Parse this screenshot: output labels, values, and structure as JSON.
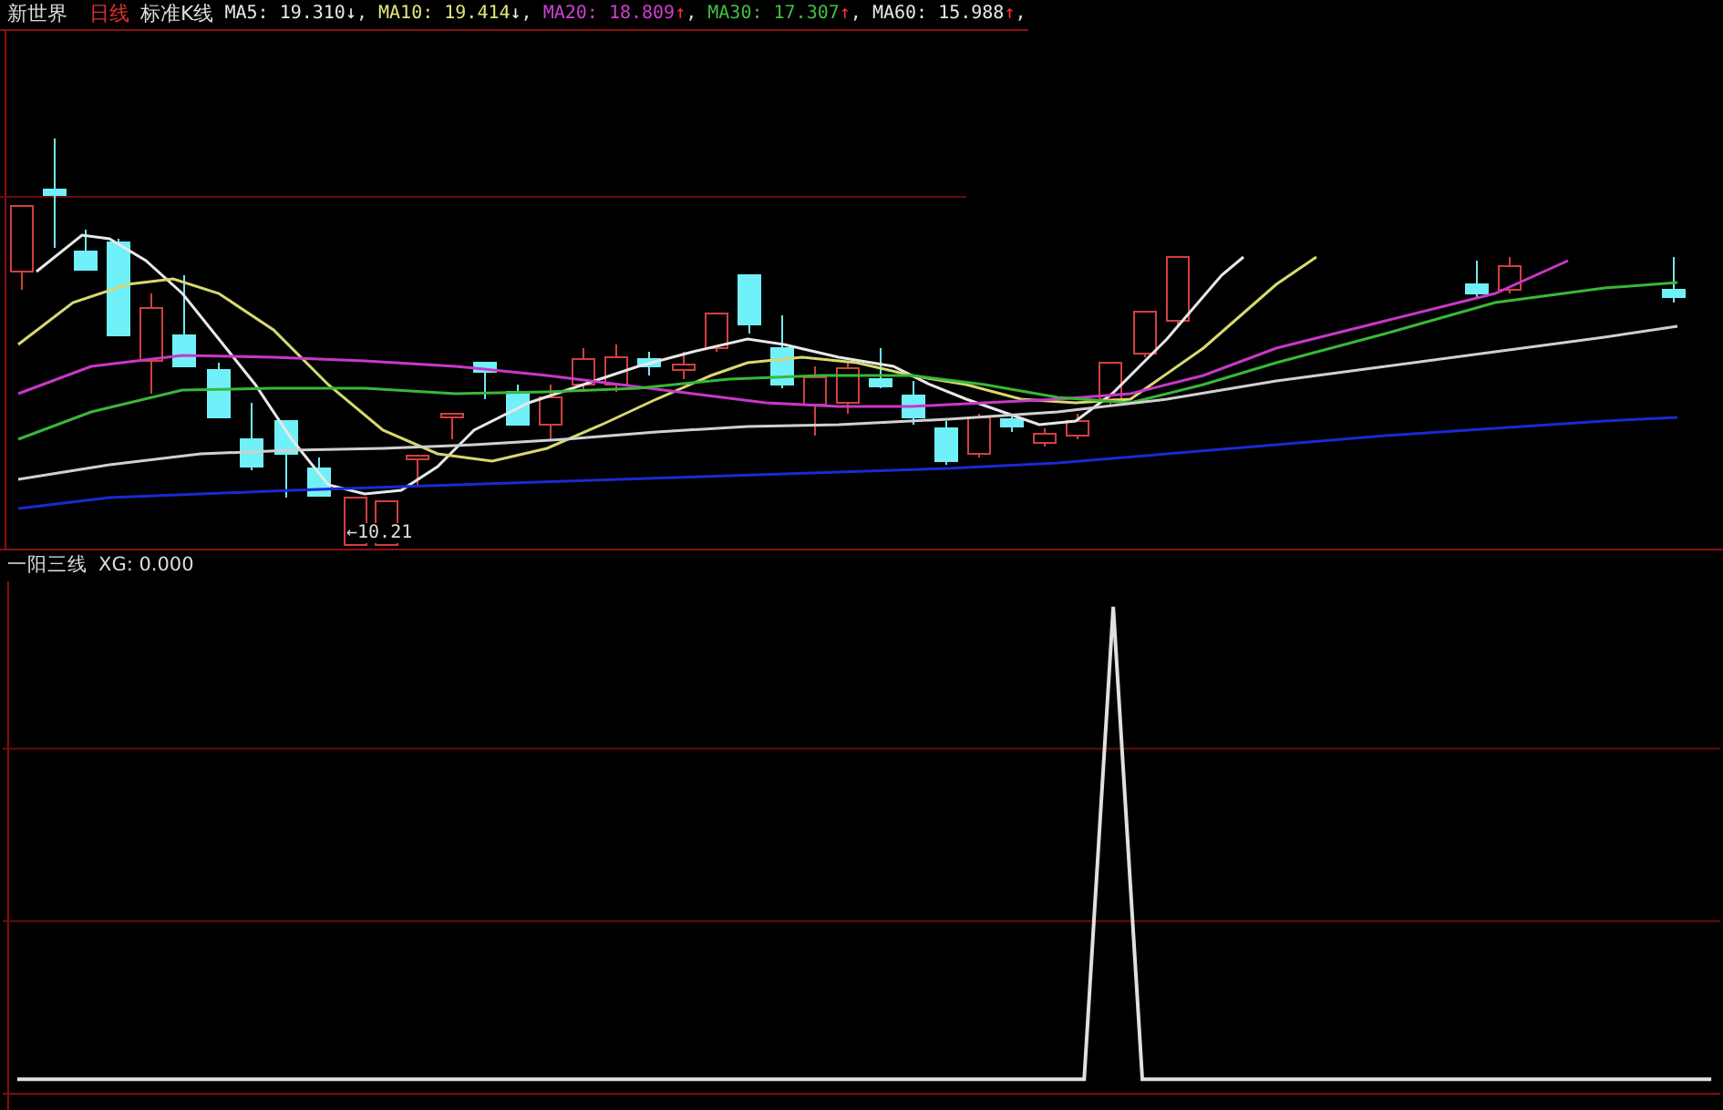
{
  "header": {
    "stock_name": "新世界",
    "period": "日线",
    "line_type": "标准K线",
    "ma_items": [
      {
        "label": "MA5:",
        "value": "19.310",
        "arrow": "↓",
        "rising": false,
        "separator": ",",
        "color": "#e8e8e8"
      },
      {
        "label": "MA10:",
        "value": "19.414",
        "arrow": "↓",
        "rising": false,
        "separator": ",",
        "color": "#e6e67a"
      },
      {
        "label": "MA20:",
        "value": "18.809",
        "arrow": "↑",
        "rising": true,
        "separator": ",",
        "color": "#d040d0"
      },
      {
        "label": "MA30:",
        "value": "17.307",
        "arrow": "↑",
        "rising": true,
        "separator": ",",
        "color": "#40c040"
      },
      {
        "label": "MA60:",
        "value": "15.988",
        "arrow": "↑",
        "rising": true,
        "separator": ",",
        "color": "#e8e8e8"
      }
    ]
  },
  "main_chart": {
    "marker_label": "←10.21"
  },
  "indicator": {
    "title": "一阳三线",
    "reading": "XG: 0.000"
  }
}
